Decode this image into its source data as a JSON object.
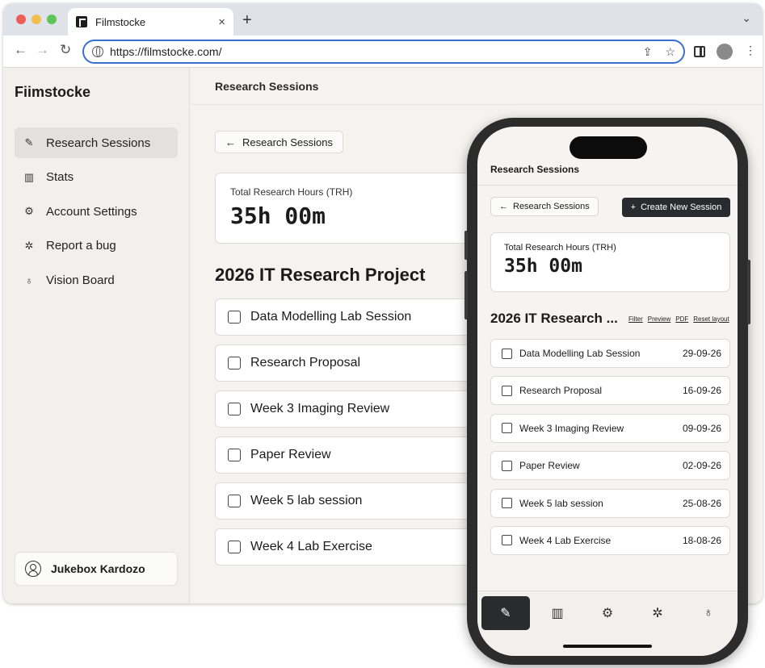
{
  "browser": {
    "tab_title": "Filmstocke",
    "tab_close": "×",
    "new_tab": "+",
    "tab_menu": "⌄",
    "url": "https://filmstocke.com/"
  },
  "sidebar": {
    "brand": "Fiimstocke",
    "items": [
      {
        "label": "Research Sessions",
        "icon": "edit-icon",
        "glyph": "✎"
      },
      {
        "label": "Stats",
        "icon": "bar-chart-icon",
        "glyph": "▥"
      },
      {
        "label": "Account Settings",
        "icon": "gear-icon",
        "glyph": "⚙"
      },
      {
        "label": "Report a bug",
        "icon": "bug-icon",
        "glyph": "✲"
      },
      {
        "label": "Vision Board",
        "icon": "lightbulb-icon",
        "glyph": "♁"
      }
    ],
    "user": "Jukebox Kardozo"
  },
  "main": {
    "header": "Research Sessions",
    "back_label": "Research Sessions",
    "stat_label": "Total Research Hours (TRH)",
    "stat_value": "35h 00m",
    "project_title": "2026 IT Research Project",
    "tasks": [
      "Data Modelling Lab Session",
      "Research Proposal",
      "Week 3 Imaging Review",
      "Paper Review",
      "Week 5 lab session",
      "Week 4 Lab Exercise"
    ]
  },
  "phone": {
    "header": "Research Sessions",
    "back_label": "Research Sessions",
    "create_label": "Create New Session",
    "stat_label": "Total Research Hours (TRH)",
    "stat_value": "35h 00m",
    "project_title": "2026 IT Research ...",
    "links": [
      "Filter",
      "Preview",
      "PDF",
      "Reset layout"
    ],
    "tasks": [
      {
        "name": "Data Modelling Lab Session",
        "date": "29-09-26"
      },
      {
        "name": "Research Proposal",
        "date": "16-09-26"
      },
      {
        "name": "Week 3 Imaging Review",
        "date": "09-09-26"
      },
      {
        "name": "Paper Review",
        "date": "02-09-26"
      },
      {
        "name": "Week 5 lab session",
        "date": "25-08-26"
      },
      {
        "name": "Week 4 Lab Exercise",
        "date": "18-08-26"
      }
    ],
    "tabbar": [
      {
        "icon": "edit-icon",
        "glyph": "✎"
      },
      {
        "icon": "bar-chart-icon",
        "glyph": "▥"
      },
      {
        "icon": "gear-icon",
        "glyph": "⚙"
      },
      {
        "icon": "bug-icon",
        "glyph": "✲"
      },
      {
        "icon": "lightbulb-icon",
        "glyph": "♁"
      }
    ]
  },
  "colors": {
    "url_focus": "#3a6fd1",
    "dark_button": "#2a2b2e",
    "page_bg": "#f4f3f0"
  }
}
